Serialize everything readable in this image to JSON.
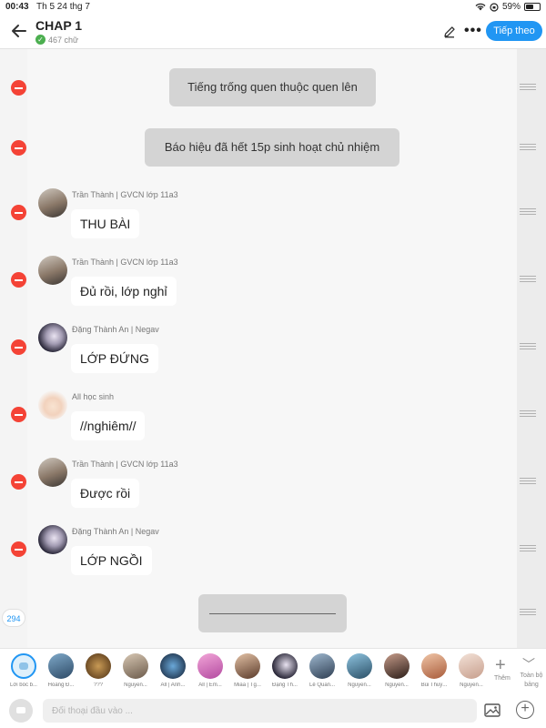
{
  "status_bar": {
    "time": "00:43",
    "date": "Th 5 24 thg 7",
    "battery": "59%",
    "battery_level": 0.59
  },
  "header": {
    "title": "CHAP 1",
    "word_count": "467 chữ",
    "follow_label": "Tiếp theo"
  },
  "narrations": [
    "Tiếng trống quen thuộc quen lên",
    "Báo hiệu đã hết 15p sinh hoạt chủ nhiệm"
  ],
  "messages": [
    {
      "sender": "Trần Thành | GVCN lớp 11a3",
      "text": "THU BÀI"
    },
    {
      "sender": "Trần Thành | GVCN lớp 11a3",
      "text": "Đủ rồi, lớp nghỉ"
    },
    {
      "sender": "Đặng Thành An | Negav",
      "text": "LỚP ĐỨNG"
    },
    {
      "sender": "All học sinh",
      "text": "//nghiêm//"
    },
    {
      "sender": "Trần Thành | GVCN lớp 11a3",
      "text": "Được rồi"
    },
    {
      "sender": "Đặng Thành An | Negav",
      "text": "LỚP NGỒI"
    }
  ],
  "message_count": "294",
  "characters": [
    {
      "label": "Lời bốc b..."
    },
    {
      "label": "Hoàng Đ..."
    },
    {
      "label": "???"
    },
    {
      "label": "Nguyễn..."
    },
    {
      "label": "All | Anh..."
    },
    {
      "label": "All | Em..."
    },
    {
      "label": "Miaa | Tg..."
    },
    {
      "label": "Đặng Th..."
    },
    {
      "label": "Lê Quan..."
    },
    {
      "label": "Nguyễn..."
    },
    {
      "label": "Nguyễn..."
    },
    {
      "label": "Bùi Thuỳ..."
    },
    {
      "label": "Nguyễn..."
    }
  ],
  "add_label": "Thêm",
  "all_label": "Toàn bộ bảng",
  "input": {
    "placeholder": "Đối thoại đầu vào ..."
  }
}
